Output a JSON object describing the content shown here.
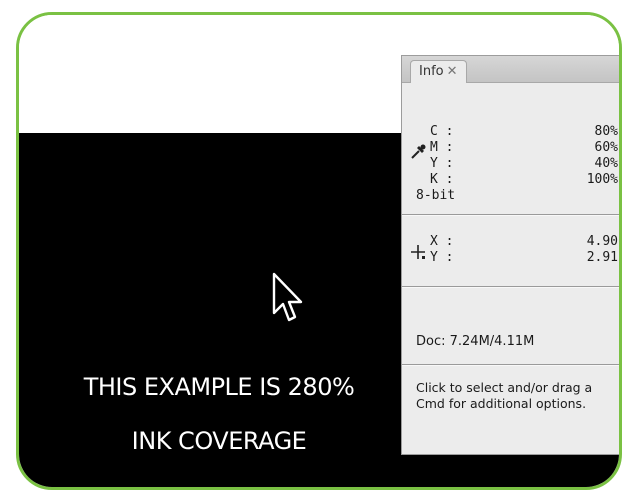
{
  "caption": {
    "line1": "THIS EXAMPLE IS 280%",
    "line2": "INK COVERAGE"
  },
  "info_panel": {
    "tab_label": "Info",
    "tab_close": "✕",
    "cmyk": [
      {
        "label": "C :",
        "value": "80%"
      },
      {
        "label": "M :",
        "value": "60%"
      },
      {
        "label": "Y :",
        "value": "40%"
      },
      {
        "label": "K :",
        "value": "100%"
      }
    ],
    "bit_depth": "8-bit",
    "coords": [
      {
        "label": "X :",
        "value": "4.90"
      },
      {
        "label": "Y :",
        "value": "2.91"
      }
    ],
    "doc_size": "Doc: 7.24M/4.11M",
    "hint_line1": "Click to select and/or drag a",
    "hint_line2": "Cmd for additional options."
  },
  "icons": {
    "eyedropper": "eyedropper-icon",
    "crosshair": "crosshair-icon",
    "cursor": "arrow-cursor-icon"
  },
  "colors": {
    "frame_border": "#7ac143",
    "canvas_fill": "#000000",
    "panel_bg": "#ececec"
  }
}
